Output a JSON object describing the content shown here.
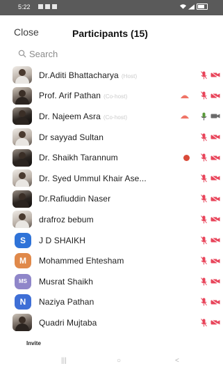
{
  "status_bar": {
    "time": "5:22"
  },
  "header": {
    "close_label": "Close",
    "title": "Participants (15)"
  },
  "search": {
    "placeholder": "Search"
  },
  "participants": [
    {
      "name": "Dr.Aditi Bhattacharya",
      "tag": "(Host)",
      "avatar": "photo",
      "mic": "muted",
      "video": "off"
    },
    {
      "name": "Prof. Arif Pathan",
      "tag": "(Co-host)",
      "avatar": "photo",
      "hand": "raised",
      "mic": "muted",
      "video": "off"
    },
    {
      "name": "Dr. Najeem Asra",
      "tag": "(Co-host)",
      "avatar": "photo",
      "hand": "raised",
      "mic": "on",
      "video": "on"
    },
    {
      "name": "Dr sayyad Sultan",
      "avatar": "photo",
      "mic": "muted",
      "video": "off"
    },
    {
      "name": "Dr. Shaikh Tarannum",
      "avatar": "photo",
      "badge": true,
      "mic": "muted",
      "video": "off"
    },
    {
      "name": "Dr. Syed Ummul Khair Ase...",
      "avatar": "photo",
      "mic": "muted",
      "video": "off"
    },
    {
      "name": "Dr.Rafiuddin Naser",
      "avatar": "photo",
      "mic": "muted",
      "video": "off"
    },
    {
      "name": "drafroz bebum",
      "avatar": "photo",
      "mic": "muted",
      "video": "off"
    },
    {
      "name": "J D SHAIKH",
      "avatar": "initial",
      "initial": "S",
      "color": "#2f73d8",
      "mic": "muted",
      "video": "off"
    },
    {
      "name": "Mohammed Ehtesham",
      "avatar": "initial",
      "initial": "M",
      "color": "#e0894a",
      "mic": "muted",
      "video": "off"
    },
    {
      "name": "Musrat Shaikh",
      "avatar": "initial",
      "initial": "MS",
      "color": "#8f86c9",
      "mic": "muted",
      "video": "off"
    },
    {
      "name": "Naziya Pathan",
      "avatar": "initial",
      "initial": "N",
      "color": "#3f6fd6",
      "mic": "muted",
      "video": "off"
    },
    {
      "name": "Quadri Mujtaba",
      "avatar": "photo",
      "mic": "muted",
      "video": "off"
    }
  ],
  "footer": {
    "invite_label": "Invite"
  },
  "colors": {
    "muted": "#e8445a",
    "video_off": "#e8445a",
    "hand": "#ef7466",
    "badge": "#d94b3a"
  }
}
